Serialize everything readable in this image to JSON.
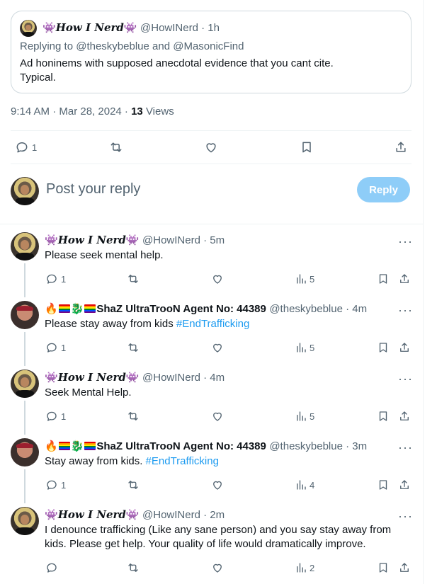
{
  "quoted": {
    "name": "How I Nerd",
    "handle": "@HowINerd",
    "time": "1h",
    "replying_prefix": "Replying to ",
    "replying_to_1": "@theskybeblue",
    "replying_and": " and ",
    "replying_to_2": "@MasonicFind",
    "text_line1": "Ad honinems with supposed anecdotal evidence that you cant cite.",
    "text_line2": "Typical."
  },
  "meta": {
    "datetime": "9:14 AM · Mar 28, 2024 · ",
    "views_count": "13",
    "views_label": " Views"
  },
  "main_actions": {
    "reply_count": "1"
  },
  "composer": {
    "placeholder": "Post your reply",
    "reply_button": "Reply"
  },
  "replies": [
    {
      "name": "How I Nerd",
      "handle": "@HowINerd",
      "time": "5m",
      "text": "Please seek mental help.",
      "reply_count": "1",
      "views": "5"
    },
    {
      "name": "ShaZ UltraTrooN Agent No: 44389",
      "handle": "@theskybeblue",
      "time": "4m",
      "text": "Please stay away from kids ",
      "hashtag": "#EndTrafficking",
      "reply_count": "1",
      "views": "5"
    },
    {
      "name": "How I Nerd",
      "handle": "@HowINerd",
      "time": "4m",
      "text": "Seek Mental Help.",
      "reply_count": "1",
      "views": "5"
    },
    {
      "name": "ShaZ UltraTrooN Agent No: 44389",
      "handle": "@theskybeblue",
      "time": "3m",
      "text": "Stay away from kids. ",
      "hashtag": "#EndTrafficking",
      "reply_count": "1",
      "views": "4"
    },
    {
      "name": "How I Nerd",
      "handle": "@HowINerd",
      "time": "2m",
      "text_line1": "I denounce trafficking (Like any sane person) and you say stay away from",
      "text_line2": "kids. Please get help. Your quality of life would dramatically improve.",
      "views": "2"
    }
  ],
  "ui": {
    "separator": " · ",
    "more": "···"
  },
  "colors": {
    "accent": "#1d9bf0",
    "reply_button_disabled": "#8ecdf8",
    "muted_text": "#536471"
  },
  "icons": [
    "reply-icon",
    "retweet-icon",
    "like-icon",
    "bookmark-icon",
    "share-icon",
    "views-icon",
    "more-icon"
  ]
}
